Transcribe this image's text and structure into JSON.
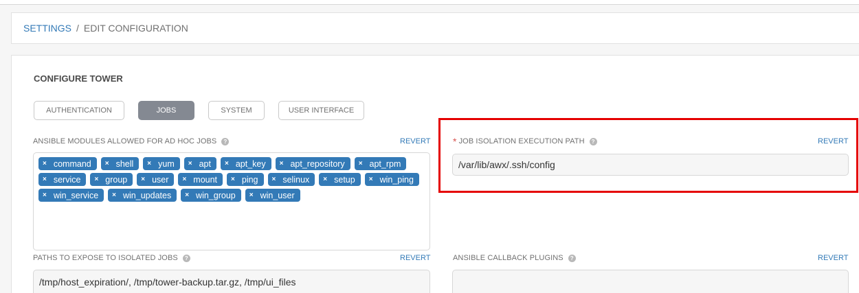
{
  "breadcrumb": {
    "root": "SETTINGS",
    "separator": "/",
    "current": "EDIT CONFIGURATION"
  },
  "panel": {
    "title": "CONFIGURE TOWER"
  },
  "tabs": [
    {
      "label": "AUTHENTICATION",
      "active": false
    },
    {
      "label": "JOBS",
      "active": true
    },
    {
      "label": "SYSTEM",
      "active": false
    },
    {
      "label": "USER INTERFACE",
      "active": false
    }
  ],
  "fields": {
    "adhoc_modules": {
      "label": "ANSIBLE MODULES ALLOWED FOR AD HOC JOBS",
      "revert": "REVERT",
      "tags": [
        "command",
        "shell",
        "yum",
        "apt",
        "apt_key",
        "apt_repository",
        "apt_rpm",
        "service",
        "group",
        "user",
        "mount",
        "ping",
        "selinux",
        "setup",
        "win_ping",
        "win_service",
        "win_updates",
        "win_group",
        "win_user"
      ]
    },
    "isolation_path": {
      "label": "JOB ISOLATION EXECUTION PATH",
      "required_mark": "*",
      "revert": "REVERT",
      "value": "/var/lib/awx/.ssh/config"
    },
    "expose_paths": {
      "label": "PATHS TO EXPOSE TO ISOLATED JOBS",
      "revert": "REVERT",
      "value": "/tmp/host_expiration/, /tmp/tower-backup.tar.gz, /tmp/ui_files"
    },
    "callback_plugins": {
      "label": "ANSIBLE CALLBACK PLUGINS",
      "revert": "REVERT",
      "value": ""
    }
  },
  "icons": {
    "help": "question-circle-icon",
    "tag_remove": "close-icon"
  },
  "colors": {
    "link": "#337ab7",
    "tag_bg": "#337ab7",
    "active_tab": "#848992",
    "highlight": "#e50000",
    "required": "#d9534f"
  }
}
